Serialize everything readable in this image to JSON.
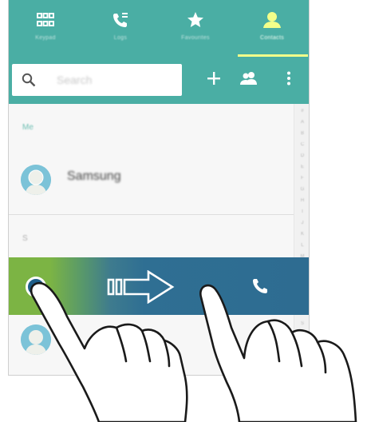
{
  "tabs": [
    {
      "id": "keypad",
      "icon": "keypad-icon",
      "label": "Keypad",
      "active": false
    },
    {
      "id": "logs",
      "icon": "call-logs-icon",
      "label": "Logs",
      "active": false
    },
    {
      "id": "favourites",
      "icon": "star-icon",
      "label": "Favourites",
      "active": false
    },
    {
      "id": "contacts",
      "icon": "contact-person-icon",
      "label": "Contacts",
      "active": true
    }
  ],
  "search": {
    "placeholder": "Search"
  },
  "toolbar": [
    {
      "icon": "add-icon",
      "label": ""
    },
    {
      "icon": "groups-icon",
      "label": ""
    },
    {
      "icon": "more-options-icon",
      "label": ""
    }
  ],
  "contacts": {
    "section_header_1": "Me",
    "my_profile": {
      "name": "Samsung"
    },
    "section_header_2": "S"
  },
  "index_letters": [
    "#",
    "A",
    "B",
    "C",
    "D",
    "E",
    "F",
    "G",
    "H",
    "I",
    "J",
    "K",
    "L",
    "M",
    "N",
    "O",
    "P",
    "Q",
    "R",
    "S",
    "T",
    "U",
    "V",
    "W"
  ],
  "swipe_row": {
    "action_icon": "phone-call-icon",
    "arrow_icon": "swipe-right-arrow-icon",
    "gesture": "swipe-right-to-call"
  },
  "colors": {
    "accent": "#4aaea4",
    "tab_underline": "#f2ff8a",
    "swipe_start": "#7cb444",
    "swipe_end": "#2e6c91"
  }
}
